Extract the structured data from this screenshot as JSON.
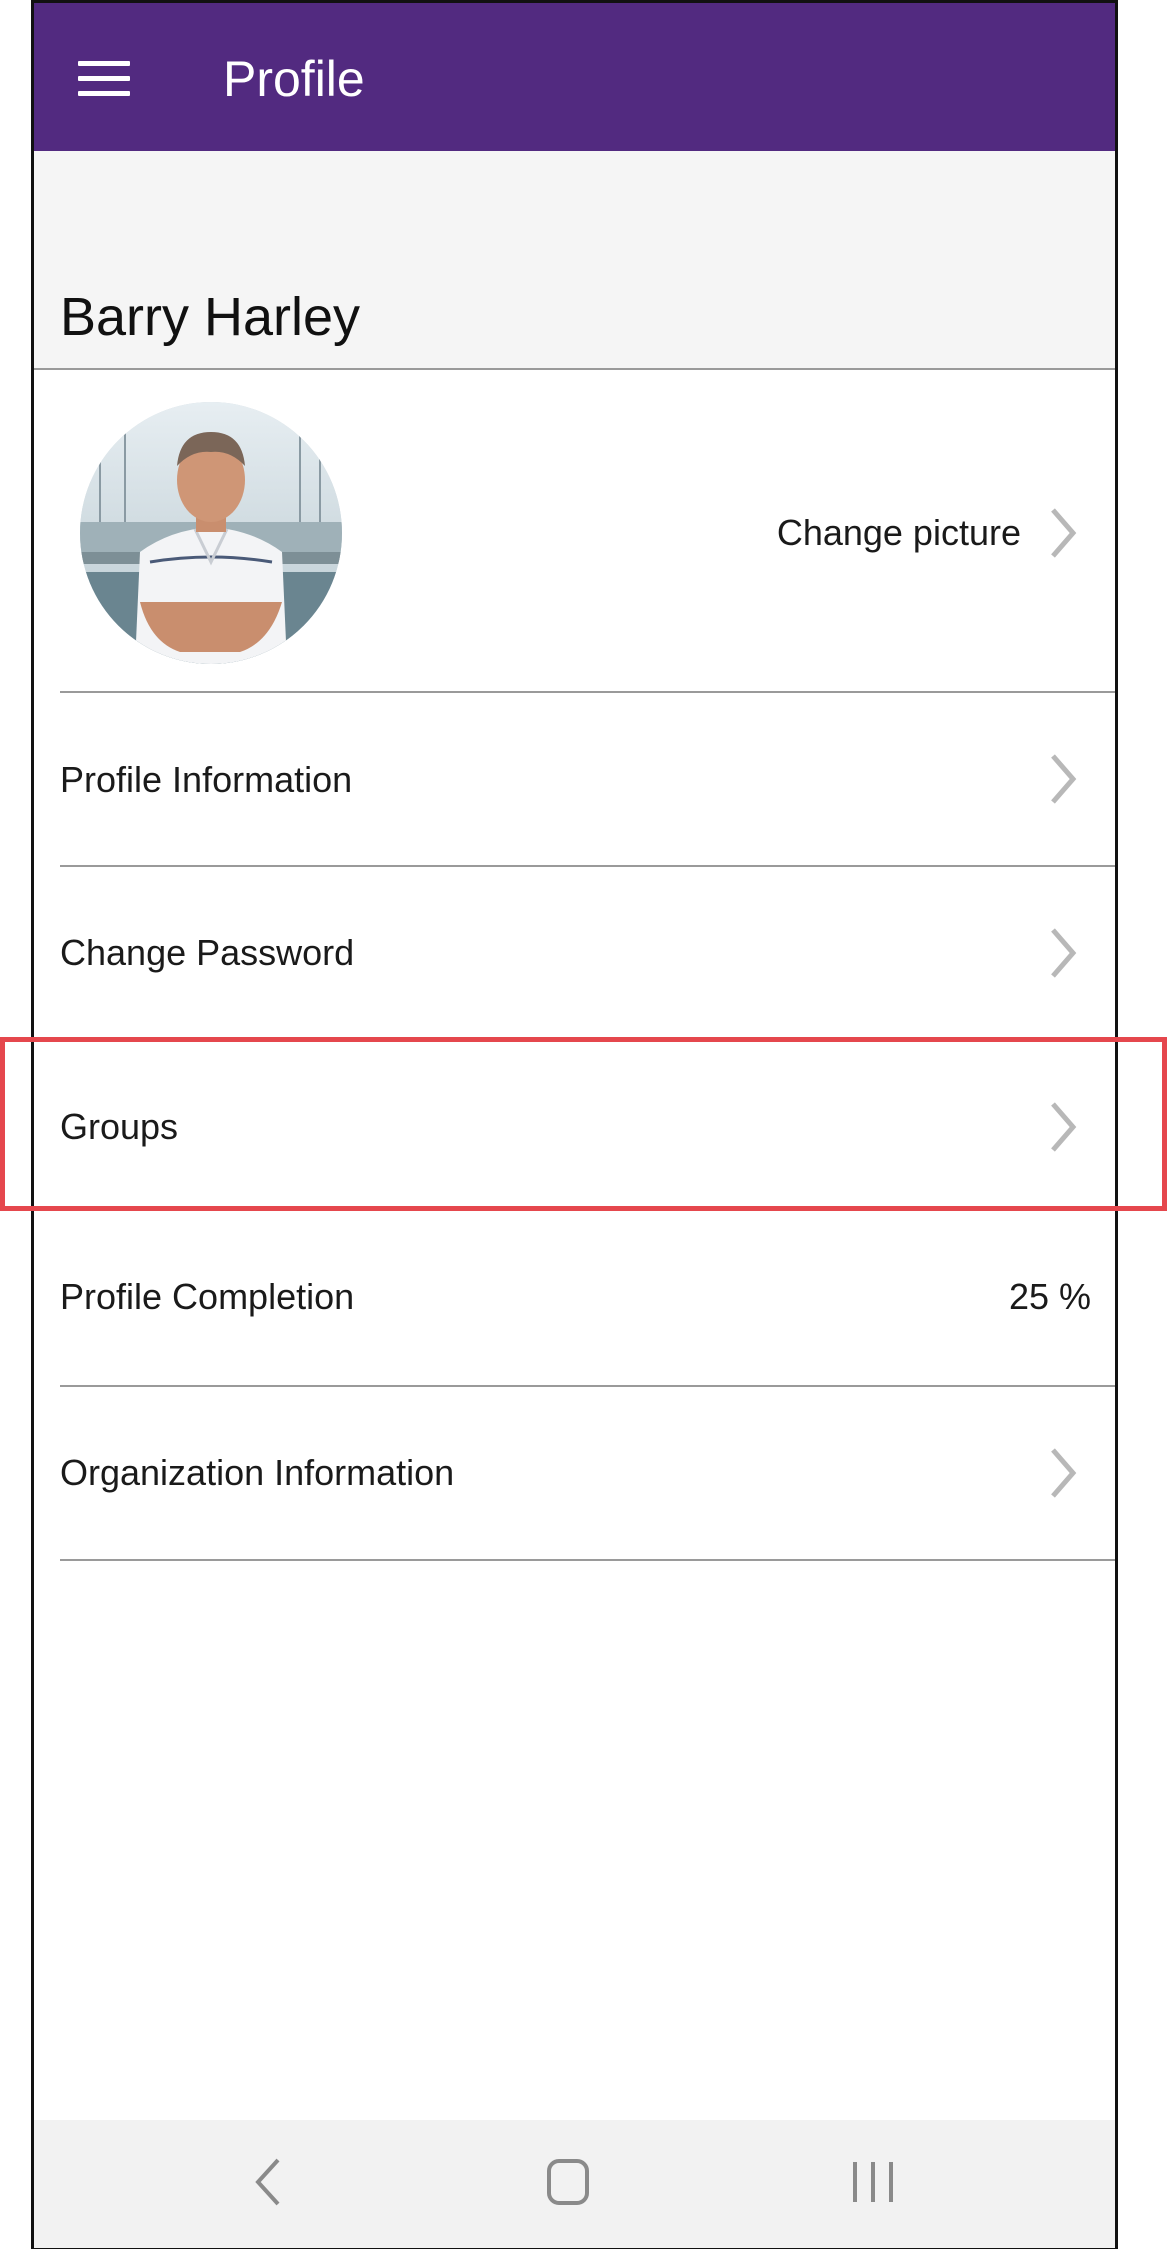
{
  "app_bar": {
    "title": "Profile",
    "menu_icon": "hamburger-menu-icon",
    "background_color": "#522a80"
  },
  "profile": {
    "name": "Barry Harley",
    "avatar_icon": "profile-photo",
    "change_picture_label": "Change picture"
  },
  "menu": {
    "profile_information": "Profile Information",
    "change_password": "Change Password",
    "groups": "Groups",
    "profile_completion_label": "Profile Completion",
    "profile_completion_value": "25 %",
    "organization_information": "Organization Information"
  },
  "icons": {
    "chevron": "chevron-right-icon",
    "nav_back": "back-icon",
    "nav_home": "home-icon",
    "nav_recents": "recents-icon"
  },
  "highlight": {
    "target": "Groups",
    "color": "#e5474d"
  }
}
